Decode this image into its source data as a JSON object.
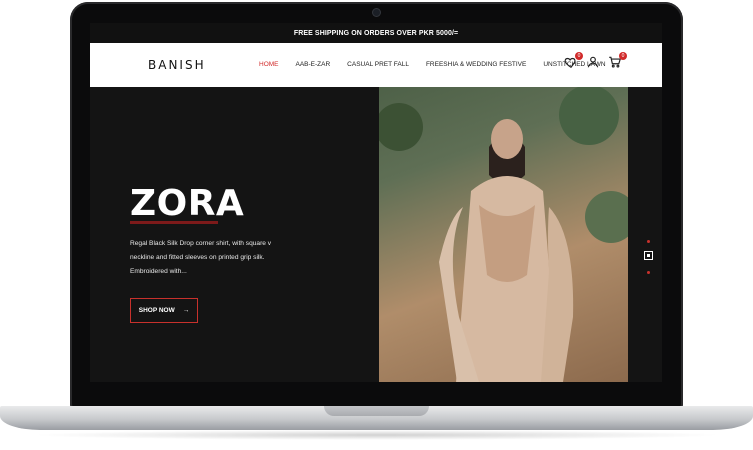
{
  "announcement": "FREE SHIPPING ON ORDERS OVER PKR 5000/=",
  "brand": "BANISH",
  "nav": [
    "HOME",
    "AAB-E-ZAR",
    "CASUAL PRET FALL",
    "FREESHIA & WEDDING FESTIVE",
    "UNSTITCHED LAWN"
  ],
  "header_icons": [
    {
      "name": "wishlist-icon",
      "badge": "0"
    },
    {
      "name": "account-icon"
    },
    {
      "name": "cart-icon",
      "badge": "0"
    }
  ],
  "hero": {
    "title": "ZORA",
    "description": "Regal Black Silk Drop corner shirt, with square v neckline and fitted sleeves on printed grip silk. Embroidered with...",
    "button_label": "SHOP NOW",
    "button_icon": "arrow-right-icon"
  },
  "colors": {
    "accent": "#d12a2a",
    "background": "#141414",
    "header": "#ffffff"
  }
}
